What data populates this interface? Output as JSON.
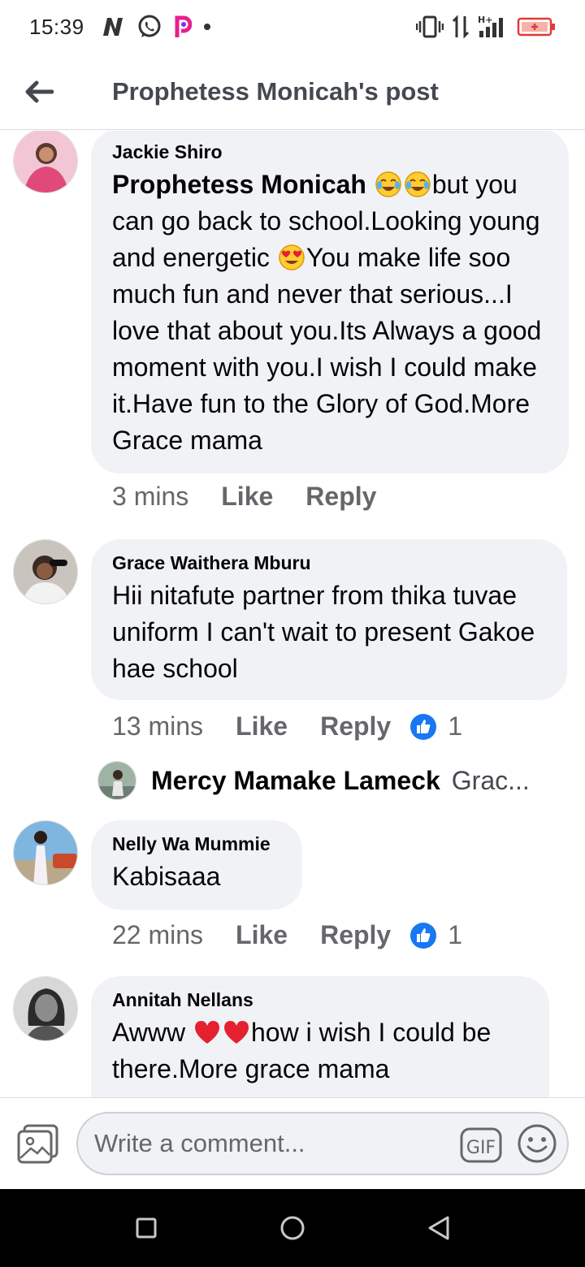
{
  "status_bar": {
    "time": "15:39",
    "network_label": "H+",
    "battery_color": "#e53935"
  },
  "header": {
    "title": "Prophetess Monicah's post",
    "back_icon": "arrow-left-icon"
  },
  "comments": [
    {
      "author": "Jackie Shiro",
      "tag": "Prophetess Monicah",
      "text_parts": [
        "but you can go back to school.Looking young and energetic ",
        "You make life soo much fun and never that serious...I love that about you.Its Always a good moment with you.I wish I could make it.Have fun to the Glory of God.More Grace mama"
      ],
      "time": "3 mins",
      "like": "Like",
      "reply": "Reply"
    },
    {
      "author": "Grace Waithera Mburu",
      "text": "Hii nitafute partner from thika tuvae uniform I can't wait to present Gakoe hae school",
      "time": "13 mins",
      "like": "Like",
      "reply": "Reply",
      "reaction_count": "1",
      "reply_preview": {
        "author": "Mercy Mamake Lameck",
        "snippet": "Grac..."
      }
    },
    {
      "author": "Nelly Wa Mummie",
      "text": "Kabisaaa",
      "time": "22 mins",
      "like": "Like",
      "reply": "Reply",
      "reaction_count": "1"
    },
    {
      "author": "Annitah Nellans",
      "text_parts": [
        "Awww ",
        "how i wish I could be there.More grace mama"
      ]
    }
  ],
  "composer": {
    "placeholder": "Write a comment...",
    "gif_label": "GIF"
  },
  "colors": {
    "bubble": "#f0f2f5",
    "like_blue": "#1877f2",
    "meta_gray": "#65676b"
  }
}
